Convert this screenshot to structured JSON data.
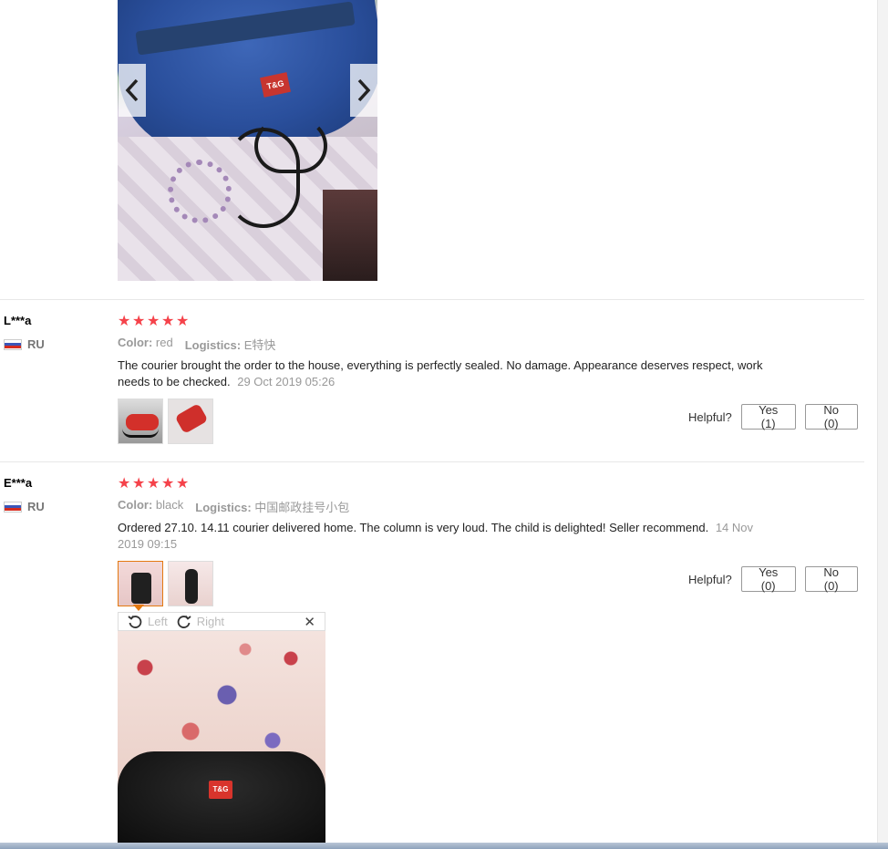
{
  "top_image": {
    "logo_text": "T&G"
  },
  "reviews": [
    {
      "name": "L***a",
      "country": "RU",
      "stars": 5,
      "color_label": "Color:",
      "color_value": "red",
      "logistics_label": "Logistics:",
      "logistics_value": "E特快",
      "text": "The courier brought the order to the house, everything is perfectly sealed. No damage. Appearance deserves respect, work needs to be checked.",
      "date": "29 Oct 2019 05:26",
      "helpful_label": "Helpful?",
      "yes_label": "Yes (1)",
      "no_label": "No (0)"
    },
    {
      "name": "E***a",
      "country": "RU",
      "stars": 5,
      "color_label": "Color:",
      "color_value": "black",
      "logistics_label": "Logistics:",
      "logistics_value": "中国邮政挂号小包",
      "text": "Ordered 27.10. 14.11 courier delivered home. The column is very loud. The child is delighted! Seller recommend.",
      "date": "14 Nov 2019 09:15",
      "helpful_label": "Helpful?",
      "yes_label": "Yes (0)",
      "no_label": "No (0)"
    }
  ],
  "viewer": {
    "rotate_left_label": "Left",
    "rotate_right_label": "Right",
    "close_glyph": "✕",
    "logo_text": "T&G"
  },
  "star_glyph": "★"
}
